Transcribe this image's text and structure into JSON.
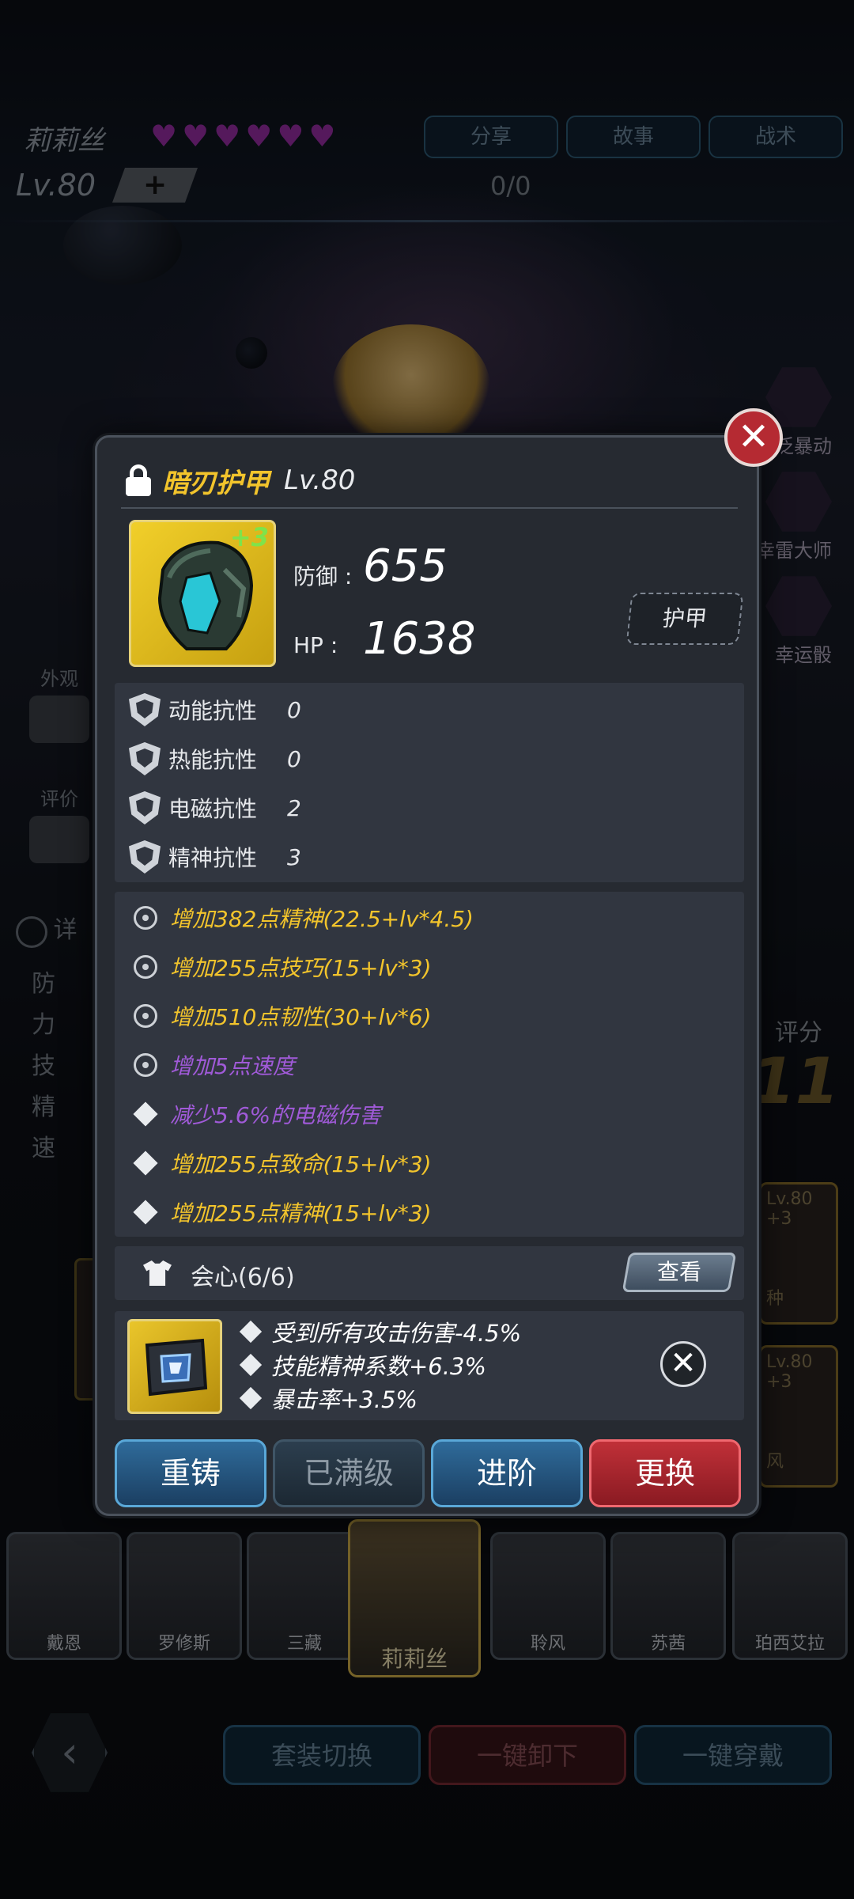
{
  "background": {
    "hero_name": "莉莉丝",
    "hearts": 6,
    "level": "Lv.80",
    "plus": "+",
    "exp": "0/0",
    "top_buttons": [
      "分享",
      "故事",
      "战术"
    ],
    "side_skills": [
      "泛暴动",
      "幸雷大师",
      "幸运骰"
    ],
    "left_labels": [
      "外观",
      "评价",
      "详"
    ],
    "left_stats": [
      "防",
      "力",
      "技",
      "精",
      "速"
    ],
    "score_label": "评分",
    "score_value": "11",
    "right_cards": [
      {
        "level": "Lv.80",
        "plus": "+3",
        "name": "种"
      },
      {
        "level": "Lv.80",
        "plus": "+3",
        "name": "风"
      }
    ],
    "roster": [
      "戴恩",
      "罗修斯",
      "三藏",
      "莉莉丝",
      "聆风",
      "苏茜",
      "珀西艾拉"
    ],
    "bottom_buttons": [
      "套装切换",
      "一键卸下",
      "一键穿戴"
    ]
  },
  "modal": {
    "item_name": "暗刃护甲",
    "item_level": "Lv.80",
    "enhance": "+3",
    "defense_label": "防御 :",
    "defense_value": "655",
    "hp_label": "HP :",
    "hp_value": "1638",
    "item_type": "护甲",
    "resistances": [
      {
        "name": "动能抗性",
        "value": "0"
      },
      {
        "name": "热能抗性",
        "value": "0"
      },
      {
        "name": "电磁抗性",
        "value": "2"
      },
      {
        "name": "精神抗性",
        "value": "3"
      }
    ],
    "attributes": [
      {
        "text": "增加382点精神(22.5+lv*4.5)",
        "color": "#f2c42c",
        "icon": "gear"
      },
      {
        "text": "增加255点技巧(15+lv*3)",
        "color": "#f2c42c",
        "icon": "gear"
      },
      {
        "text": "增加510点韧性(30+lv*6)",
        "color": "#f2c42c",
        "icon": "gear"
      },
      {
        "text": "增加5点速度",
        "color": "#a05ad8",
        "icon": "gear"
      },
      {
        "text": "减少5.6%的电磁伤害",
        "color": "#a05ad8",
        "icon": "diamond"
      },
      {
        "text": "增加255点致命(15+lv*3)",
        "color": "#f2c42c",
        "icon": "diamond"
      },
      {
        "text": "增加255点精神(15+lv*3)",
        "color": "#f2c42c",
        "icon": "diamond"
      }
    ],
    "set_name": "会心(6/6)",
    "view_label": "查看",
    "gem_effects": [
      "受到所有攻击伤害-4.5%",
      "技能精神系数+6.3%",
      "暴击率+3.5%"
    ],
    "actions": [
      {
        "label": "重铸",
        "style": "blue"
      },
      {
        "label": "已满级",
        "style": "disabled"
      },
      {
        "label": "进阶",
        "style": "blue"
      },
      {
        "label": "更换",
        "style": "red"
      }
    ]
  }
}
